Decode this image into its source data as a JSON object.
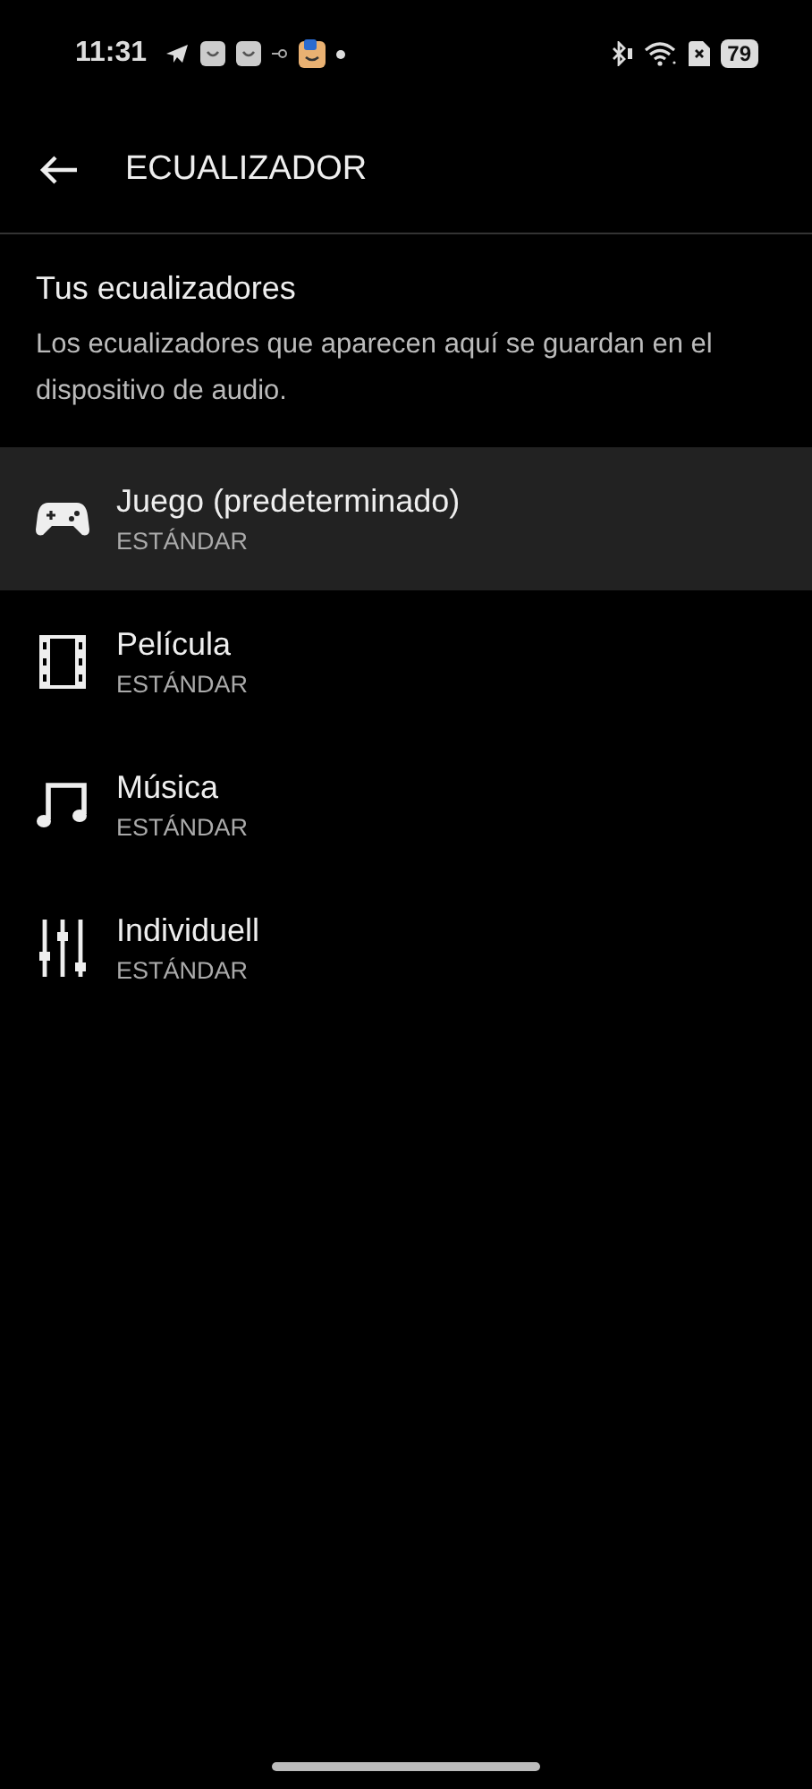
{
  "status_bar": {
    "time": "11:31",
    "battery": "79"
  },
  "header": {
    "title": "ECUALIZADOR"
  },
  "section": {
    "title": "Tus ecualizadores",
    "description": "Los ecualizadores que aparecen aquí se guardan en el dispositivo de audio."
  },
  "equalizers": [
    {
      "kind": "game",
      "name": "Juego (predeterminado)",
      "subtitle": "ESTÁNDAR",
      "selected": true
    },
    {
      "kind": "film",
      "name": "Película",
      "subtitle": "ESTÁNDAR",
      "selected": false
    },
    {
      "kind": "music",
      "name": "Música",
      "subtitle": "ESTÁNDAR",
      "selected": false
    },
    {
      "kind": "custom",
      "name": "Individuell",
      "subtitle": "ESTÁNDAR",
      "selected": false
    }
  ]
}
